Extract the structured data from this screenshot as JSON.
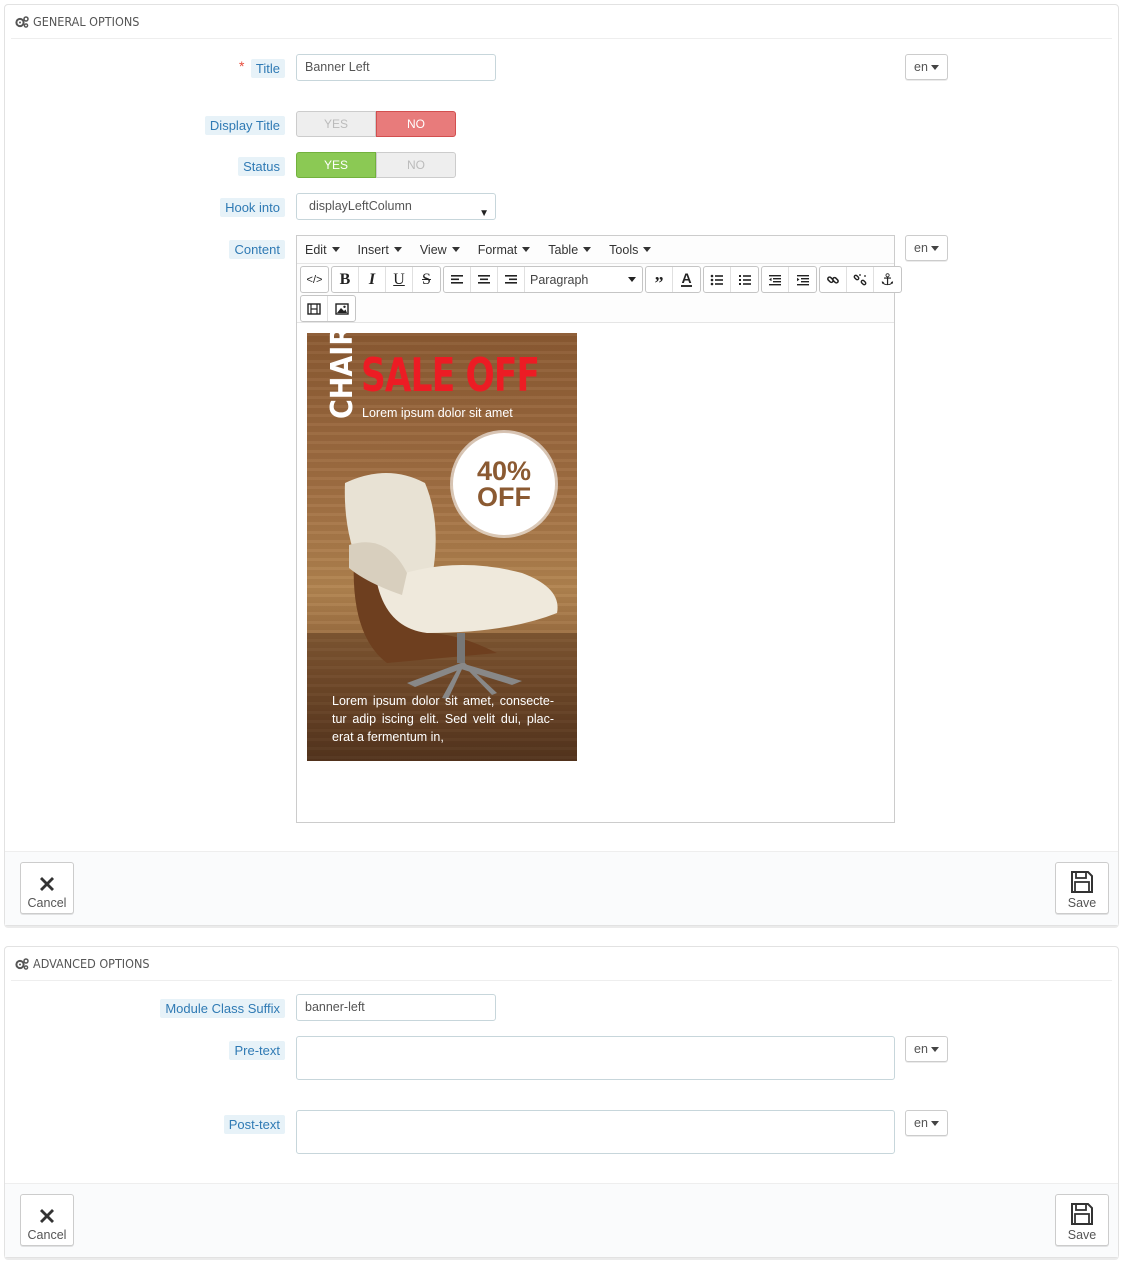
{
  "general": {
    "heading": "GENERAL OPTIONS",
    "title_label": "Title",
    "required_mark": "*",
    "title_value": "Banner Left",
    "lang": "en",
    "display_title_label": "Display Title",
    "status_label": "Status",
    "yes": "YES",
    "no": "NO",
    "hook_label": "Hook into",
    "hook_value": "displayLeftColumn",
    "content_label": "Content",
    "editor": {
      "menus": [
        "Edit",
        "Insert",
        "View",
        "Format",
        "Table",
        "Tools"
      ],
      "format_select": "Paragraph"
    },
    "banner": {
      "chair": "CHAIR",
      "sale": "SALE OFF",
      "subtitle": "Lorem ipsum dolor sit amet",
      "badge_line1": "40%",
      "badge_line2": "OFF",
      "body": "Lorem ipsum dolor sit amet, consecte-tur adip iscing elit. Sed velit dui, plac-erat a fermentum in,"
    },
    "cancel": "Cancel",
    "save": "Save"
  },
  "advanced": {
    "heading": "ADVANCED OPTIONS",
    "suffix_label": "Module Class Suffix",
    "suffix_value": "banner-left",
    "pretext_label": "Pre-text",
    "posttext_label": "Post-text",
    "lang": "en",
    "cancel": "Cancel",
    "save": "Save"
  },
  "colors": {
    "label_bg": "#e7f2f8",
    "label_text": "#2f7ab4",
    "no_active": "#e87b7b",
    "yes_active": "#8bc954",
    "required": "#e74c3c"
  }
}
